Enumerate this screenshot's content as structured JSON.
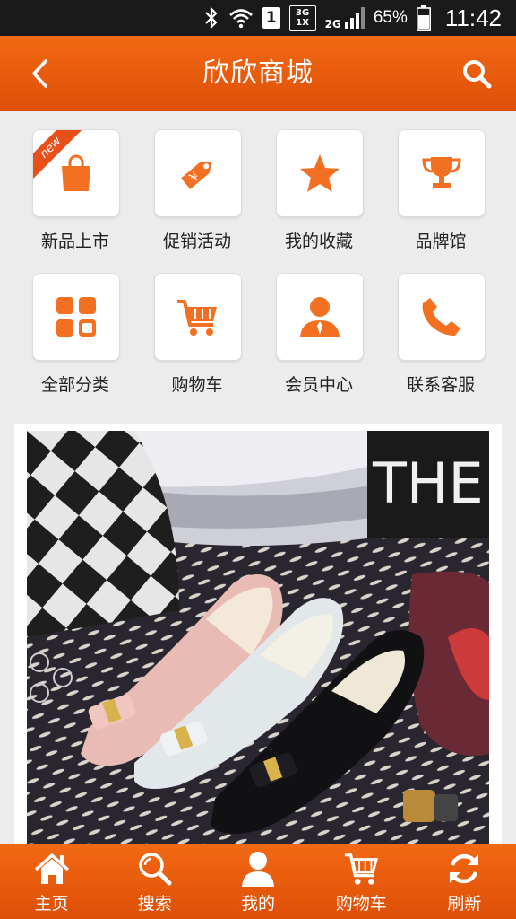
{
  "status_bar": {
    "sim": "1",
    "net_top": "3G",
    "net_bottom": "1X",
    "net_2g": "2G",
    "battery": "65%",
    "time": "11:42"
  },
  "header": {
    "title": "欣欣商城"
  },
  "grid": {
    "items": [
      {
        "label": "新品上市",
        "icon": "shopping-bag-icon",
        "badge": "new"
      },
      {
        "label": "促销活动",
        "icon": "price-tag-icon"
      },
      {
        "label": "我的收藏",
        "icon": "star-icon"
      },
      {
        "label": "品牌馆",
        "icon": "trophy-icon"
      },
      {
        "label": "全部分类",
        "icon": "category-grid-icon"
      },
      {
        "label": "购物车",
        "icon": "cart-icon"
      },
      {
        "label": "会员中心",
        "icon": "member-icon"
      },
      {
        "label": "联系客服",
        "icon": "phone-icon"
      }
    ]
  },
  "banner": {
    "sign_text": "THE"
  },
  "bottom_nav": {
    "items": [
      {
        "label": "主页",
        "icon": "home-icon"
      },
      {
        "label": "搜索",
        "icon": "search-icon"
      },
      {
        "label": "我的",
        "icon": "user-icon"
      },
      {
        "label": "购物车",
        "icon": "cart-icon"
      },
      {
        "label": "刷新",
        "icon": "refresh-icon"
      }
    ]
  },
  "colors": {
    "accent": "#f26914",
    "icon": "#f37022",
    "background": "#ececec"
  }
}
